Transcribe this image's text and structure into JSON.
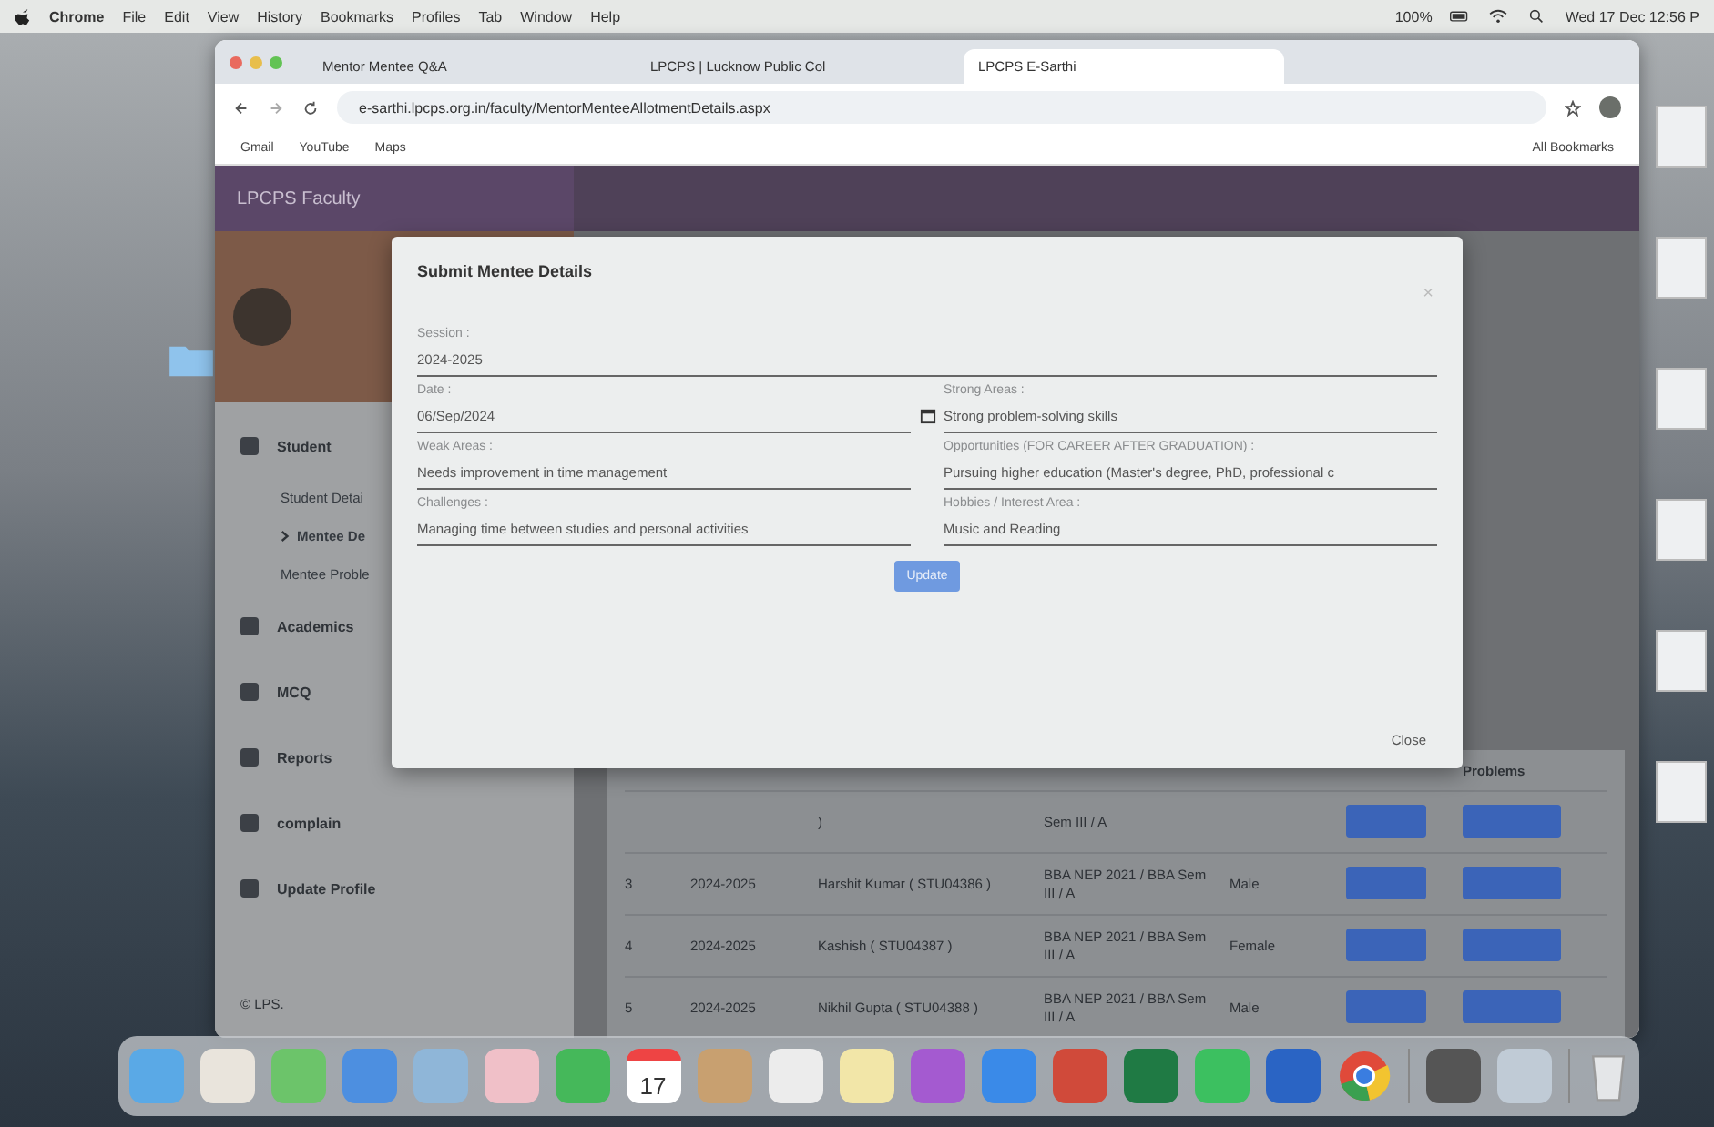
{
  "menubar": {
    "app": "Chrome",
    "menus": [
      "File",
      "Edit",
      "View",
      "History",
      "Bookmarks",
      "Profiles",
      "Tab",
      "Window",
      "Help"
    ],
    "zoom": "100%",
    "clock": "Wed 17 Dec 12:56 P"
  },
  "browser": {
    "tabs": [
      {
        "label": "Mentor Mentee Q&A",
        "selected": false
      },
      {
        "label": "LPCPS | Lucknow Public Col",
        "selected": false
      },
      {
        "label": "LPCPS E-Sarthi",
        "selected": true
      }
    ],
    "url": "e-sarthi.lpcps.org.in/faculty/MentorMenteeAllotmentDetails.aspx",
    "bookmarks": [
      "Gmail",
      "YouTube",
      "Maps"
    ],
    "all_bookmarks": "All Bookmarks"
  },
  "page": {
    "brand": "LPCPS Faculty",
    "sidebar": [
      {
        "kind": "group",
        "label": "Student",
        "expanded": true,
        "children": [
          {
            "label": "Student Detai",
            "selected": false
          },
          {
            "label": "Mentee De",
            "selected": true
          },
          {
            "label": "Mentee Proble",
            "selected": false
          }
        ]
      },
      {
        "kind": "item",
        "label": "Academics"
      },
      {
        "kind": "item",
        "label": "MCQ"
      },
      {
        "kind": "group",
        "label": "Reports",
        "expanded": false
      },
      {
        "kind": "item",
        "label": "complain"
      },
      {
        "kind": "item",
        "label": "Update Profile"
      }
    ],
    "footer": "© LPS.",
    "table": {
      "problems_header": "Problems",
      "rows": [
        {
          "no": "",
          "session": "",
          "name": ")",
          "course": "Sem III / A",
          "gender": ""
        },
        {
          "no": "3",
          "session": "2024-2025",
          "name": "Harshit Kumar ( STU04386 )",
          "course": "BBA NEP 2021 / BBA Sem III / A",
          "gender": "Male"
        },
        {
          "no": "4",
          "session": "2024-2025",
          "name": "Kashish ( STU04387 )",
          "course": "BBA NEP 2021 / BBA Sem III / A",
          "gender": "Female"
        },
        {
          "no": "5",
          "session": "2024-2025",
          "name": "Nikhil Gupta ( STU04388 )",
          "course": "BBA NEP 2021 / BBA Sem III / A",
          "gender": "Male"
        }
      ]
    }
  },
  "modal": {
    "title": "Submit Mentee Details",
    "close_icon": "×",
    "session": {
      "label": "Session :",
      "value": "2024-2025"
    },
    "left": [
      {
        "label": "Date :",
        "value": "06/Sep/2024",
        "kind": "date"
      },
      {
        "label": "Weak Areas :",
        "value": "Needs improvement in time management",
        "kind": "text"
      },
      {
        "label": "Challenges :",
        "value": "Managing time between studies and personal activities",
        "kind": "text"
      }
    ],
    "right": [
      {
        "label": "Strong Areas :",
        "value": "Strong problem-solving skills",
        "kind": "text"
      },
      {
        "label": "Opportunities (FOR CAREER AFTER GRADUATION) :",
        "value": "Pursuing higher education (Master's degree, PhD, professional c",
        "kind": "text"
      },
      {
        "label": "Hobbies / Interest Area :",
        "value": "Music and Reading",
        "kind": "text"
      }
    ],
    "update": "Update",
    "close": "Close"
  },
  "dock": {
    "calendar_day": "17"
  }
}
